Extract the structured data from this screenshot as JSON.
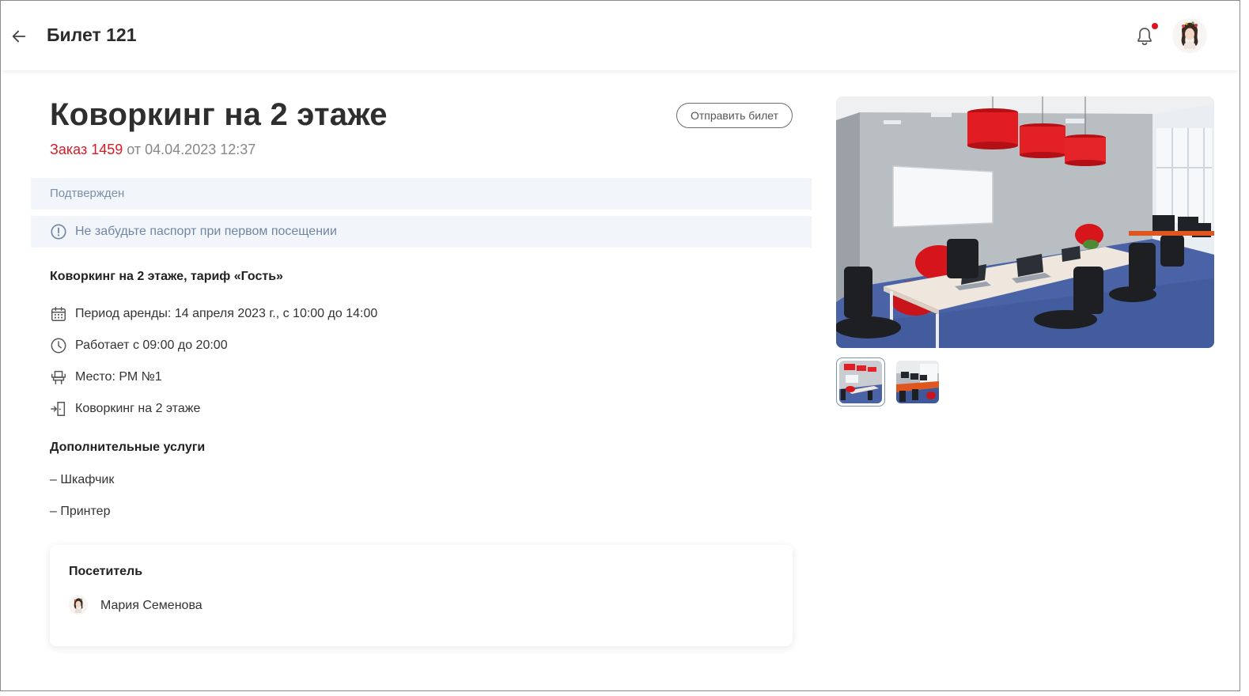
{
  "header": {
    "title": "Билет 121",
    "back_icon": "arrow-left-icon",
    "bell_icon": "bell-icon",
    "has_notification": true
  },
  "ticket": {
    "title": "Коворкинг на 2 этаже",
    "order_label": "Заказ 1459",
    "order_date": "от 04.04.2023 12:37",
    "send_button": "Отправить билет",
    "status": "Подтвержден",
    "notice": "Не забудьте паспорт при первом посещении",
    "tariff": "Коворкинг на 2 этаже, тариф «Гость»",
    "details": [
      {
        "icon": "calendar-icon",
        "text": "Период аренды: 14 апреля 2023 г., с 10:00 до 14:00"
      },
      {
        "icon": "clock-icon",
        "text": "Работает с 09:00 до 20:00"
      },
      {
        "icon": "workplace-icon",
        "text": "Место: РМ №1"
      },
      {
        "icon": "room-entry-icon",
        "text": "Коворкинг на 2 этаже"
      }
    ],
    "extras_title": "Дополнительные услуги",
    "extras": [
      "– Шкафчик",
      "– Принтер"
    ]
  },
  "visitor": {
    "title": "Посетитель",
    "name": "Мария Семенова"
  },
  "colors": {
    "accent_red": "#d91a25",
    "status_bg": "#f2f5f9",
    "status_text": "#7b8fa8"
  }
}
